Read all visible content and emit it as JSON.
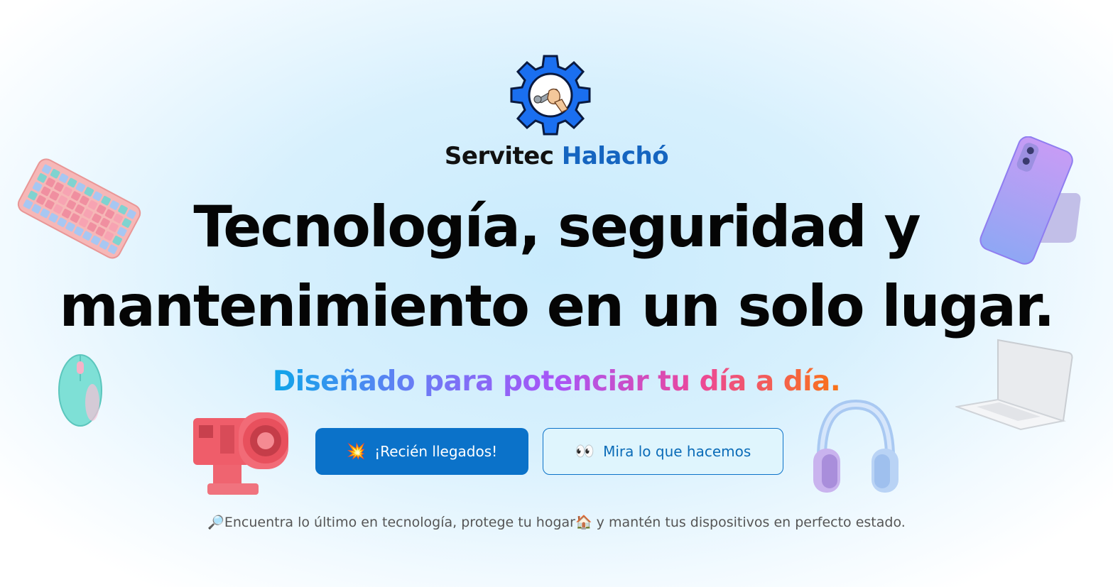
{
  "brand": {
    "name": "Servitec",
    "accent": "Halachó",
    "accent_color": "#1565c0",
    "logo_icon": "gear-wrench-icon"
  },
  "hero": {
    "headline_line1": "Tecnología, seguridad y",
    "headline_line2": "mantenimiento en un solo lugar.",
    "tagline": "Diseñado para potenciar tu día a día."
  },
  "buttons": {
    "primary": {
      "icon": "💥",
      "label": "¡Recién llegados!",
      "color": "#0b72c9"
    },
    "secondary": {
      "icon": "👀",
      "label": "Mira lo que hacemos"
    }
  },
  "footer": {
    "search_emoji": "🔎",
    "text_before": "Encuentra lo último en tecnología, protege tu hogar",
    "home_emoji": "🏠",
    "text_after": " y mantén tus dispositivos en perfecto estado."
  },
  "decorations": [
    "keyboard",
    "mouse",
    "projector",
    "headphones",
    "phone",
    "laptop"
  ]
}
